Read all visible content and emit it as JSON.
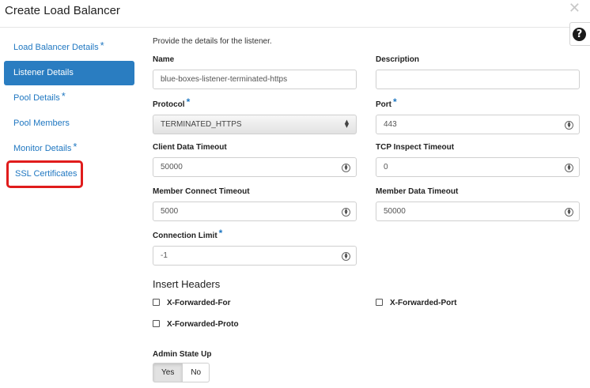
{
  "dialog": {
    "title": "Create Load Balancer",
    "close_icon": "✕",
    "help_icon": "?"
  },
  "nav": {
    "items": [
      {
        "label": "Load Balancer Details",
        "required": "*"
      },
      {
        "label": "Listener Details"
      },
      {
        "label": "Pool Details",
        "required": "*"
      },
      {
        "label": "Pool Members"
      },
      {
        "label": "Monitor Details",
        "required": "*"
      },
      {
        "label": "SSL Certificates"
      }
    ],
    "active_index": 1,
    "highlighted_index": 5,
    "accent_color": "#2a7dc1",
    "highlight_color": "#e01c1c"
  },
  "form": {
    "intro": "Provide the details for the listener.",
    "name": {
      "label": "Name",
      "value": "blue-boxes-listener-terminated-https"
    },
    "description": {
      "label": "Description",
      "value": ""
    },
    "protocol": {
      "label": "Protocol",
      "required": "*",
      "value": "TERMINATED_HTTPS"
    },
    "port": {
      "label": "Port",
      "required": "*",
      "value": "443"
    },
    "client_data_timeout": {
      "label": "Client Data Timeout",
      "value": "50000"
    },
    "tcp_inspect_timeout": {
      "label": "TCP Inspect Timeout",
      "value": "0"
    },
    "member_connect_timeout": {
      "label": "Member Connect Timeout",
      "value": "5000"
    },
    "member_data_timeout": {
      "label": "Member Data Timeout",
      "value": "50000"
    },
    "connection_limit": {
      "label": "Connection Limit",
      "required": "*",
      "value": "-1"
    }
  },
  "insert_headers": {
    "title": "Insert Headers",
    "options": [
      {
        "label": "X-Forwarded-For",
        "checked": false
      },
      {
        "label": "X-Forwarded-Port",
        "checked": false
      },
      {
        "label": "X-Forwarded-Proto",
        "checked": false
      }
    ]
  },
  "admin_state": {
    "label": "Admin State Up",
    "yes_label": "Yes",
    "no_label": "No",
    "selected": "Yes"
  }
}
